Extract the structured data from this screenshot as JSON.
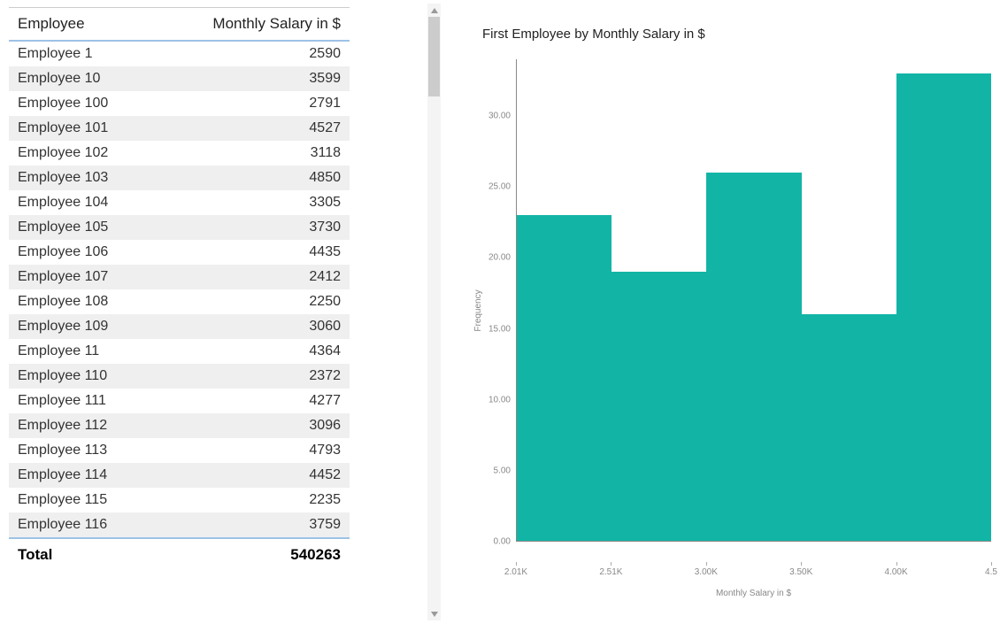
{
  "table": {
    "header_employee": "Employee",
    "header_salary": "Monthly Salary in $",
    "rows": [
      {
        "employee": "Employee 1",
        "salary": "2590"
      },
      {
        "employee": "Employee 10",
        "salary": "3599"
      },
      {
        "employee": "Employee 100",
        "salary": "2791"
      },
      {
        "employee": "Employee 101",
        "salary": "4527"
      },
      {
        "employee": "Employee 102",
        "salary": "3118"
      },
      {
        "employee": "Employee 103",
        "salary": "4850"
      },
      {
        "employee": "Employee 104",
        "salary": "3305"
      },
      {
        "employee": "Employee 105",
        "salary": "3730"
      },
      {
        "employee": "Employee 106",
        "salary": "4435"
      },
      {
        "employee": "Employee 107",
        "salary": "2412"
      },
      {
        "employee": "Employee 108",
        "salary": "2250"
      },
      {
        "employee": "Employee 109",
        "salary": "3060"
      },
      {
        "employee": "Employee 11",
        "salary": "4364"
      },
      {
        "employee": "Employee 110",
        "salary": "2372"
      },
      {
        "employee": "Employee 111",
        "salary": "4277"
      },
      {
        "employee": "Employee 112",
        "salary": "3096"
      },
      {
        "employee": "Employee 113",
        "salary": "4793"
      },
      {
        "employee": "Employee 114",
        "salary": "4452"
      },
      {
        "employee": "Employee 115",
        "salary": "2235"
      },
      {
        "employee": "Employee 116",
        "salary": "3759"
      }
    ],
    "total_label": "Total",
    "total_value": "540263"
  },
  "chart": {
    "title": "First Employee by Monthly Salary in $",
    "ylabel": "Frequency",
    "xlabel": "Monthly Salary in $",
    "yticks": [
      "0.00",
      "5.00",
      "10.00",
      "15.00",
      "20.00",
      "25.00",
      "30.00"
    ],
    "xticks": [
      "2.01K",
      "2.51K",
      "3.00K",
      "3.50K",
      "4.00K",
      "4.5"
    ]
  },
  "chart_data": {
    "type": "bar",
    "subtype": "histogram",
    "title": "First Employee by Monthly Salary in $",
    "xlabel": "Monthly Salary in $",
    "ylabel": "Frequency",
    "bin_edges": [
      2010,
      2510,
      3000,
      3500,
      4000,
      4500
    ],
    "categories": [
      "2.01K–2.51K",
      "2.51K–3.00K",
      "3.00K–3.50K",
      "3.50K–4.00K",
      "4.00K–4.50K"
    ],
    "values": [
      23,
      19,
      26,
      16,
      33
    ],
    "ylim": [
      0,
      34
    ],
    "color": "#12b5a5"
  }
}
